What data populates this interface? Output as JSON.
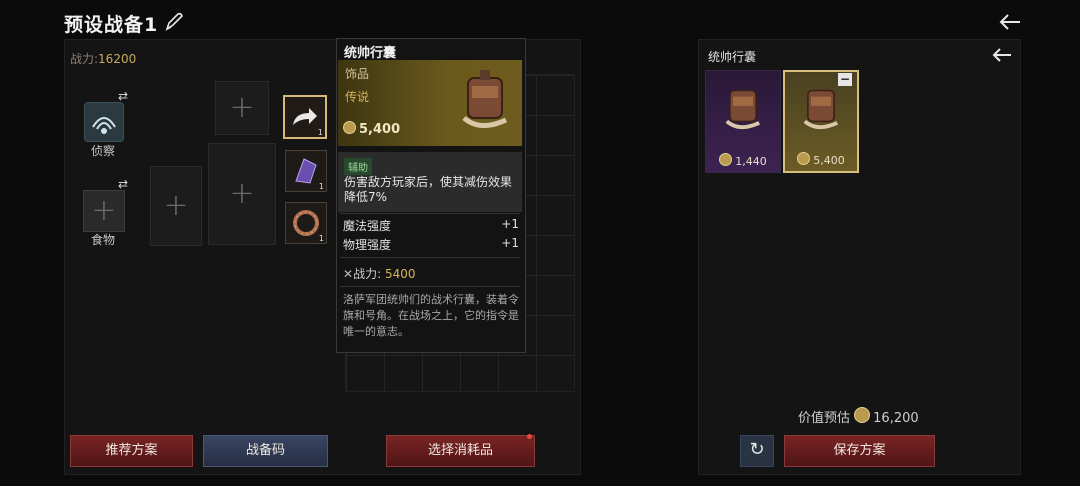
{
  "header": {
    "title": "预设战备1"
  },
  "left": {
    "power_label": "战力:",
    "power_value": "16200",
    "skill_label": "侦察",
    "food_label": "食物",
    "slot_counts": [
      "1",
      "1",
      "1"
    ],
    "buttons": {
      "recommend": "推荐方案",
      "code": "战备码",
      "consumables": "选择消耗品"
    }
  },
  "tooltip": {
    "title": "统帅行囊",
    "category": "饰品",
    "rarity": "传说",
    "price": "5,400",
    "tag": "辅助",
    "effect": "伤害敌方玩家后，使其减伤效果降低7%",
    "stats": [
      {
        "name": "魔法强度",
        "value": "+1"
      },
      {
        "name": "物理强度",
        "value": "+1"
      }
    ],
    "power_label": "战力:",
    "power_value": "5400",
    "flavor": "洛萨军团统帅们的战术行囊，装着令旗和号角。在战场之上，它的指令是唯一的意志。"
  },
  "right": {
    "title": "统帅行囊",
    "cards": [
      {
        "price": "1,440"
      },
      {
        "price": "5,400"
      }
    ],
    "value_label": "价值预估",
    "value": "16,200",
    "save_button": "保存方案"
  },
  "icons": [
    "pencil-icon",
    "back-arrow-icon",
    "swap-icon",
    "plus-icon",
    "coin-icon",
    "refresh-icon",
    "minus-icon"
  ],
  "colors": {
    "accent_gold": "#d7b87b",
    "button_red": "#7a2424",
    "button_blue": "#3a4563"
  }
}
